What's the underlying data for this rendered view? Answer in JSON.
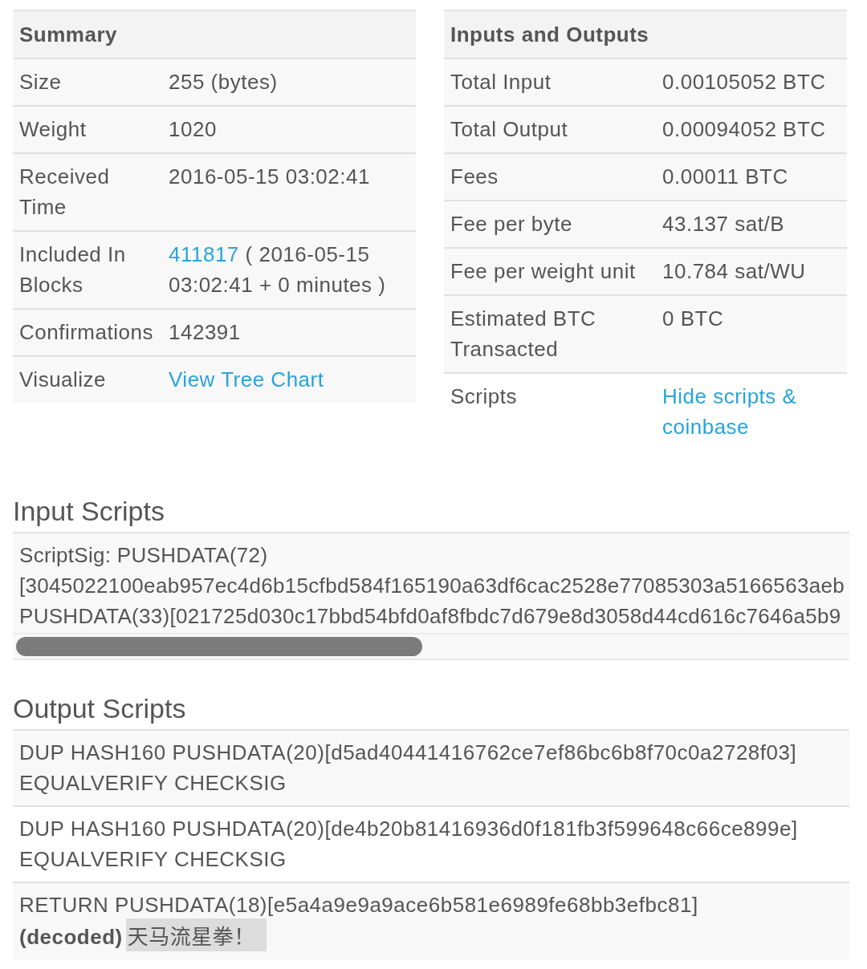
{
  "summary": {
    "title": "Summary",
    "rows": [
      {
        "label": "Size",
        "value": "255 (bytes)"
      },
      {
        "label": "Weight",
        "value": "1020"
      },
      {
        "label": "Received Time",
        "value": "2016-05-15 03:02:41"
      },
      {
        "label": "Included In Blocks",
        "link": "411817",
        "value": " ( 2016-05-15 03:02:41 + 0 minutes )"
      },
      {
        "label": "Confirmations",
        "value": "142391"
      },
      {
        "label": "Visualize",
        "link": "View Tree Chart"
      }
    ]
  },
  "inputs_outputs": {
    "title": "Inputs and Outputs",
    "rows": [
      {
        "label": "Total Input",
        "value": "0.00105052 BTC"
      },
      {
        "label": "Total Output",
        "value": "0.00094052 BTC"
      },
      {
        "label": "Fees",
        "value": "0.00011 BTC"
      },
      {
        "label": "Fee per byte",
        "value": "43.137 sat/B"
      },
      {
        "label": "Fee per weight unit",
        "value": "10.784 sat/WU"
      },
      {
        "label": "Estimated BTC Transacted",
        "value": "0 BTC"
      },
      {
        "label": "Scripts",
        "link": "Hide scripts & coinbase"
      }
    ]
  },
  "input_scripts": {
    "title": "Input Scripts",
    "lines": [
      "ScriptSig: PUSHDATA(72)",
      "[3045022100eab957ec4d6b15cfbd584f165190a63df6cac2528e77085303a5166563aeb",
      "PUSHDATA(33)[021725d030c17bbd54bfd0af8fbdc7d679e8d3058d44cd616c7646a5b9"
    ]
  },
  "output_scripts": {
    "title": "Output Scripts",
    "rows": [
      {
        "lines": [
          "DUP HASH160 PUSHDATA(20)[d5ad40441416762ce7ef86bc6b8f70c0a2728f03]",
          "EQUALVERIFY CHECKSIG"
        ]
      },
      {
        "lines": [
          "DUP HASH160 PUSHDATA(20)[de4b20b81416936d0f181fb3f599648c66ce899e]",
          "EQUALVERIFY CHECKSIG"
        ]
      },
      {
        "lines": [
          "RETURN PUSHDATA(18)[e5a4a9e9a9ace6b581e6989fe68bb3efbc81]"
        ],
        "decoded_label": "(decoded)",
        "decoded": "天马流星拳！"
      }
    ]
  }
}
